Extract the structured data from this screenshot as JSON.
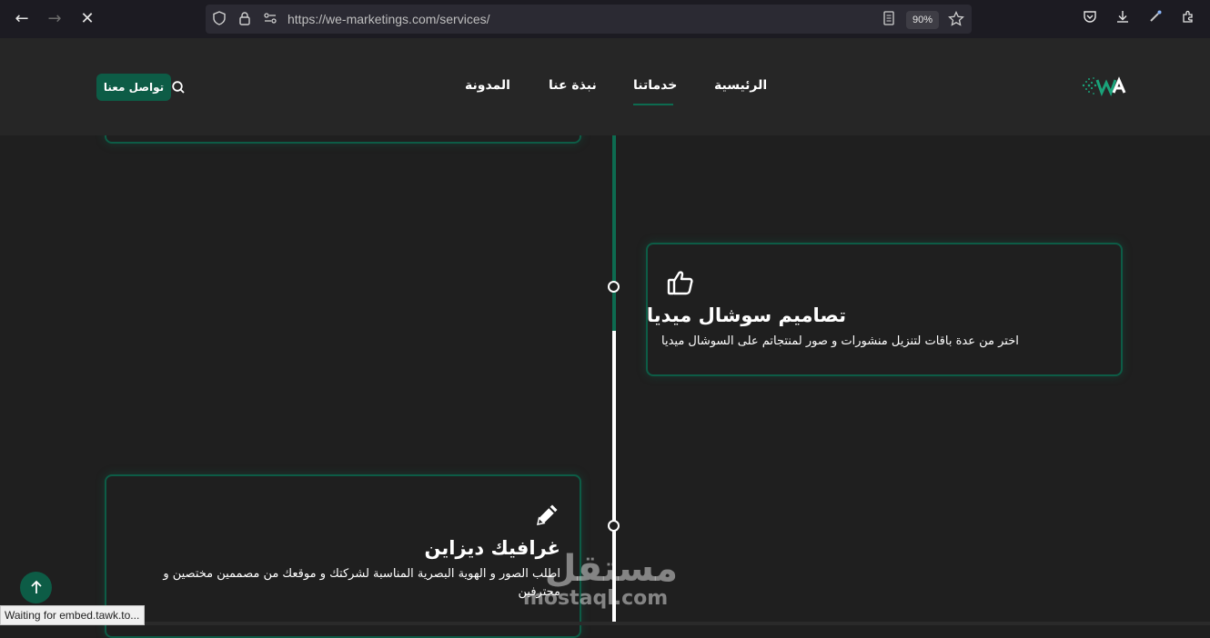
{
  "browser": {
    "url": "https://we-marketings.com/services/",
    "zoom": "90%",
    "status_text": "Waiting for embed.tawk.to..."
  },
  "header": {
    "menu": {
      "home": "الرئيسية",
      "services": "خدماتنا",
      "about": "نبذة عنا",
      "blog": "المدونة"
    },
    "active_item": "services",
    "contact_label": "تواصل معنا"
  },
  "cards": {
    "social": {
      "icon": "thumbs-up-icon",
      "title": "تصاميم سوشال ميديا",
      "description": "اختر من عدة باقات لتنزيل منشورات و صور لمنتجاتم على السوشال ميديا"
    },
    "graphic": {
      "icon": "pencil-icon",
      "title": "غرافيك ديزاين",
      "description": "اطلب الصور و الهوية البصرية المناسبة لشركتك و موقعك من مصممين مختصين و محترفين"
    }
  },
  "watermark": {
    "arabic": "مستقل",
    "latin": "mostaql.com"
  },
  "colors": {
    "accent": "#0d5c46",
    "background": "#1f1f1f",
    "header": "#262626"
  }
}
